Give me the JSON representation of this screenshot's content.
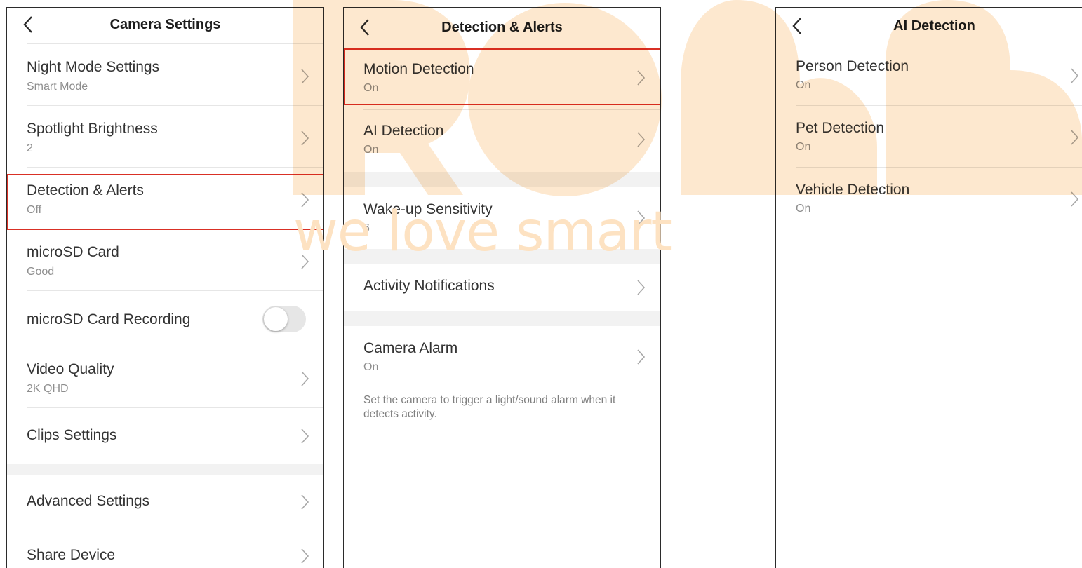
{
  "colors": {
    "highlight_border": "#d93025",
    "watermark": "#fde2c2",
    "sub_text": "#8e8e8e",
    "toggle_off": "#e6e6e6"
  },
  "watermark": {
    "logo_text": "RoBB",
    "tagline": "we love smart"
  },
  "camera_settings": {
    "title": "Camera Settings",
    "rows": [
      {
        "label": "Night Mode Settings",
        "value": "Smart Mode"
      },
      {
        "label": "Spotlight Brightness",
        "value": "2"
      },
      {
        "label": "Detection & Alerts",
        "value": "Off",
        "highlighted": true
      },
      {
        "label": "microSD Card",
        "value": "Good"
      },
      {
        "label": "microSD Card Recording",
        "toggle": "off"
      },
      {
        "label": "Video Quality",
        "value": "2K QHD"
      },
      {
        "label": "Clips Settings"
      },
      {
        "label": "Advanced Settings"
      },
      {
        "label": "Share Device"
      }
    ]
  },
  "detection_alerts": {
    "title": "Detection & Alerts",
    "rows": [
      {
        "label": "Motion Detection",
        "value": "On",
        "highlighted": true
      },
      {
        "label": "AI Detection",
        "value": "On"
      },
      {
        "label": "Wake-up Sensitivity",
        "value": "6"
      },
      {
        "label": "Activity Notifications"
      },
      {
        "label": "Camera Alarm",
        "value": "On"
      }
    ],
    "camera_alarm_note": "Set the camera to trigger a light/sound alarm when it detects activity."
  },
  "ai_detection": {
    "title": "AI Detection",
    "rows": [
      {
        "label": "Person Detection",
        "value": "On"
      },
      {
        "label": "Pet Detection",
        "value": "On"
      },
      {
        "label": "Vehicle Detection",
        "value": "On"
      }
    ]
  }
}
